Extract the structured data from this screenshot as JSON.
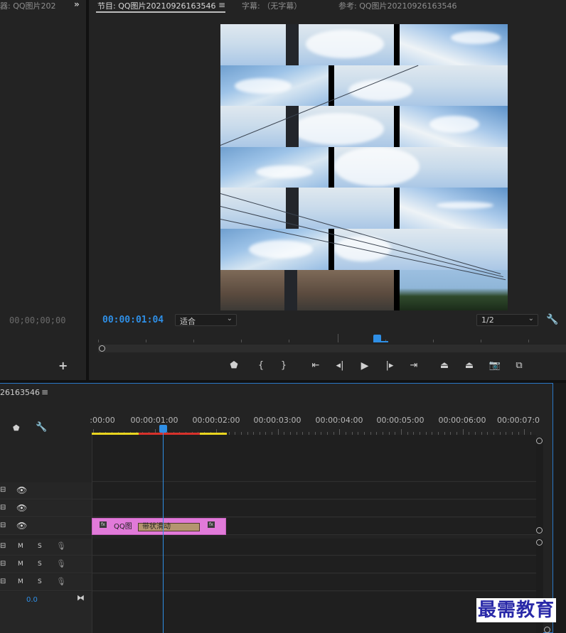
{
  "source_panel": {
    "tab_label": "器: QQ图片202",
    "timecode": "00;00;00;00"
  },
  "program_monitor": {
    "tabs": [
      {
        "label": "节目: QQ图片20210926163546",
        "active": true
      },
      {
        "label": "字幕: （无字幕）",
        "active": false
      },
      {
        "label": "参考: QQ图片20210926163546",
        "active": false
      }
    ],
    "current_timecode": "00:00:01:04",
    "fit_dropdown": "适合",
    "quality_dropdown": "1/2",
    "preview_effect": "venetian-blinds-sky-photo"
  },
  "transport_controls": [
    "add-marker-icon",
    "mark-in-icon",
    "mark-out-icon",
    "go-to-in-icon",
    "step-back-icon",
    "play-icon",
    "step-forward-icon",
    "go-to-out-icon",
    "lift-icon",
    "extract-icon",
    "export-frame-icon",
    "compare-icon"
  ],
  "timeline": {
    "sequence_name": "26163546",
    "ruler_labels": [
      ":00:00",
      "00:00:01:00",
      "00:00:02:00",
      "00:00:03:00",
      "00:00:04:00",
      "00:00:05:00",
      "00:00:06:00",
      "00:00:07:0"
    ],
    "video_tracks": 3,
    "audio_tracks": 3,
    "audio_mute_label": "M",
    "audio_solo_label": "S",
    "master_value": "0.0",
    "clip": {
      "name": "QQ图",
      "fx_label": "fx",
      "transition_label": "带状滑动",
      "color": "#e17ad9"
    }
  },
  "watermark": "最需教育",
  "colors": {
    "accent_blue": "#2f8fe6",
    "workarea_yellow": "#e9d41f",
    "workarea_red": "#d7322b"
  }
}
